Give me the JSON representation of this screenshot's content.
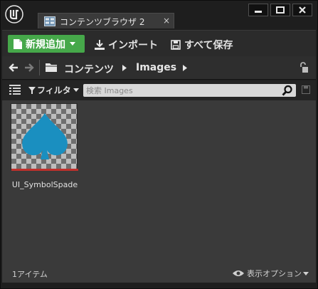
{
  "window": {
    "tab_label": "コンテンツブラウザ 2",
    "tab_close": "×"
  },
  "toolbar": {
    "add_new_label": "新規追加",
    "import_label": "インポート",
    "save_all_label": "すべて保存",
    "add_color": "#46a84a"
  },
  "breadcrumb": {
    "items": [
      "コンテンツ",
      "Images"
    ]
  },
  "filter": {
    "filter_label": "フィルタ",
    "search_placeholder": "検索 Images",
    "search_value": ""
  },
  "assets": [
    {
      "name": "UI_SymbolSpade",
      "icon": "spade-icon",
      "icon_color": "#1a8fc0",
      "type_color": "#c0302c"
    }
  ],
  "status": {
    "item_count": "1アイテム",
    "view_options_label": "表示オプション"
  }
}
